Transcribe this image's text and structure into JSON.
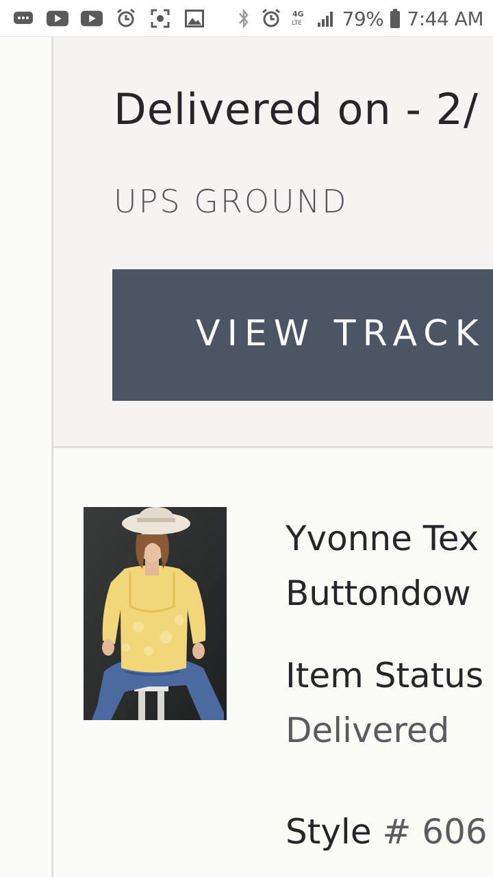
{
  "status_bar": {
    "left_icons": [
      "messages-icon",
      "youtube-icon",
      "youtube-icon",
      "alarm-snooze-icon",
      "screenshot-icon",
      "gallery-icon"
    ],
    "right_icons": [
      "bluetooth-icon",
      "alarm-icon",
      "4g-lte-icon",
      "signal-icon",
      "battery-icon"
    ],
    "battery": "79%",
    "time": "7:44 AM"
  },
  "shipment": {
    "delivered_title": "Delivered on - 2/",
    "carrier": "UPS GROUND",
    "track_button_label": "VIEW TRACK"
  },
  "item": {
    "name_line1": "Yvonne Tex",
    "name_line2": "Buttondow",
    "status_label": "Item Status",
    "status_value": "Delivered",
    "style_label": "Style",
    "style_value": "# 606"
  },
  "colors": {
    "button_bg": "#4b5563",
    "panel_bg": "#f5f4f2",
    "page_bg": "#fbfbf8",
    "text_primary": "#26252a",
    "text_secondary": "#5c5a60"
  }
}
